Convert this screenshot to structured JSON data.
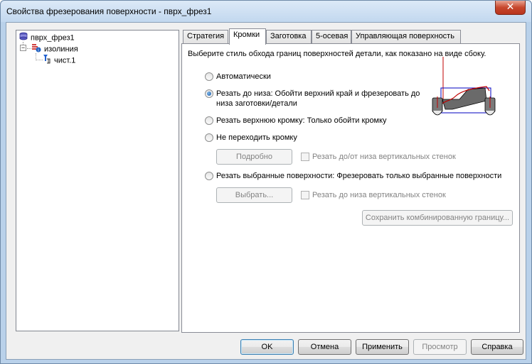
{
  "window": {
    "title": "Свойства фрезерования поверхности - пврх_фрез1",
    "close_glyph": "✕"
  },
  "tree": {
    "root": {
      "label": "пврх_фрез1",
      "icon": "surface-milling-icon"
    },
    "child": {
      "label": "изолиния",
      "icon": "isoline-icon",
      "expander": "−"
    },
    "grandchild": {
      "label": "чист.1",
      "icon": "tool-icon"
    }
  },
  "tabs": [
    {
      "label": "Стратегия"
    },
    {
      "label": "Кромки"
    },
    {
      "label": "Заготовка"
    },
    {
      "label": "5-осевая"
    },
    {
      "label": "Управляющая поверхность"
    }
  ],
  "active_tab": "Кромки",
  "edges": {
    "description": "Выберите стиль обхода границ поверхностей детали, как показано на виде сбоку.",
    "options": [
      {
        "label": "Автоматически",
        "checked": false
      },
      {
        "label": "Резать до низа: Обойти верхний край и фрезеровать до",
        "label2": "низа заготовки/детали",
        "checked": true
      },
      {
        "label": "Резать верхнюю кромку: Только обойти кромку",
        "checked": false
      },
      {
        "label": "Не переходить кромку",
        "checked": false
      },
      {
        "label": "Резать выбранные поверхности: Фрезеровать только выбранные поверхности",
        "checked": false
      }
    ],
    "detail_button": "Подробно",
    "detail_checkbox": "Резать до/от низа вертикальных стенок",
    "select_button": "Выбрать...",
    "select_checkbox": "Резать до низа вертикальных стенок",
    "save_boundary_button": "Сохранить комбинированную границу..."
  },
  "footer": {
    "ok": "OK",
    "cancel": "Отмена",
    "apply": "Применить",
    "preview": "Просмотр",
    "help": "Справка"
  },
  "colors": {
    "diagram_part": "#6a6a6a",
    "diagram_path": "#c00000",
    "diagram_box": "#0000c0"
  }
}
